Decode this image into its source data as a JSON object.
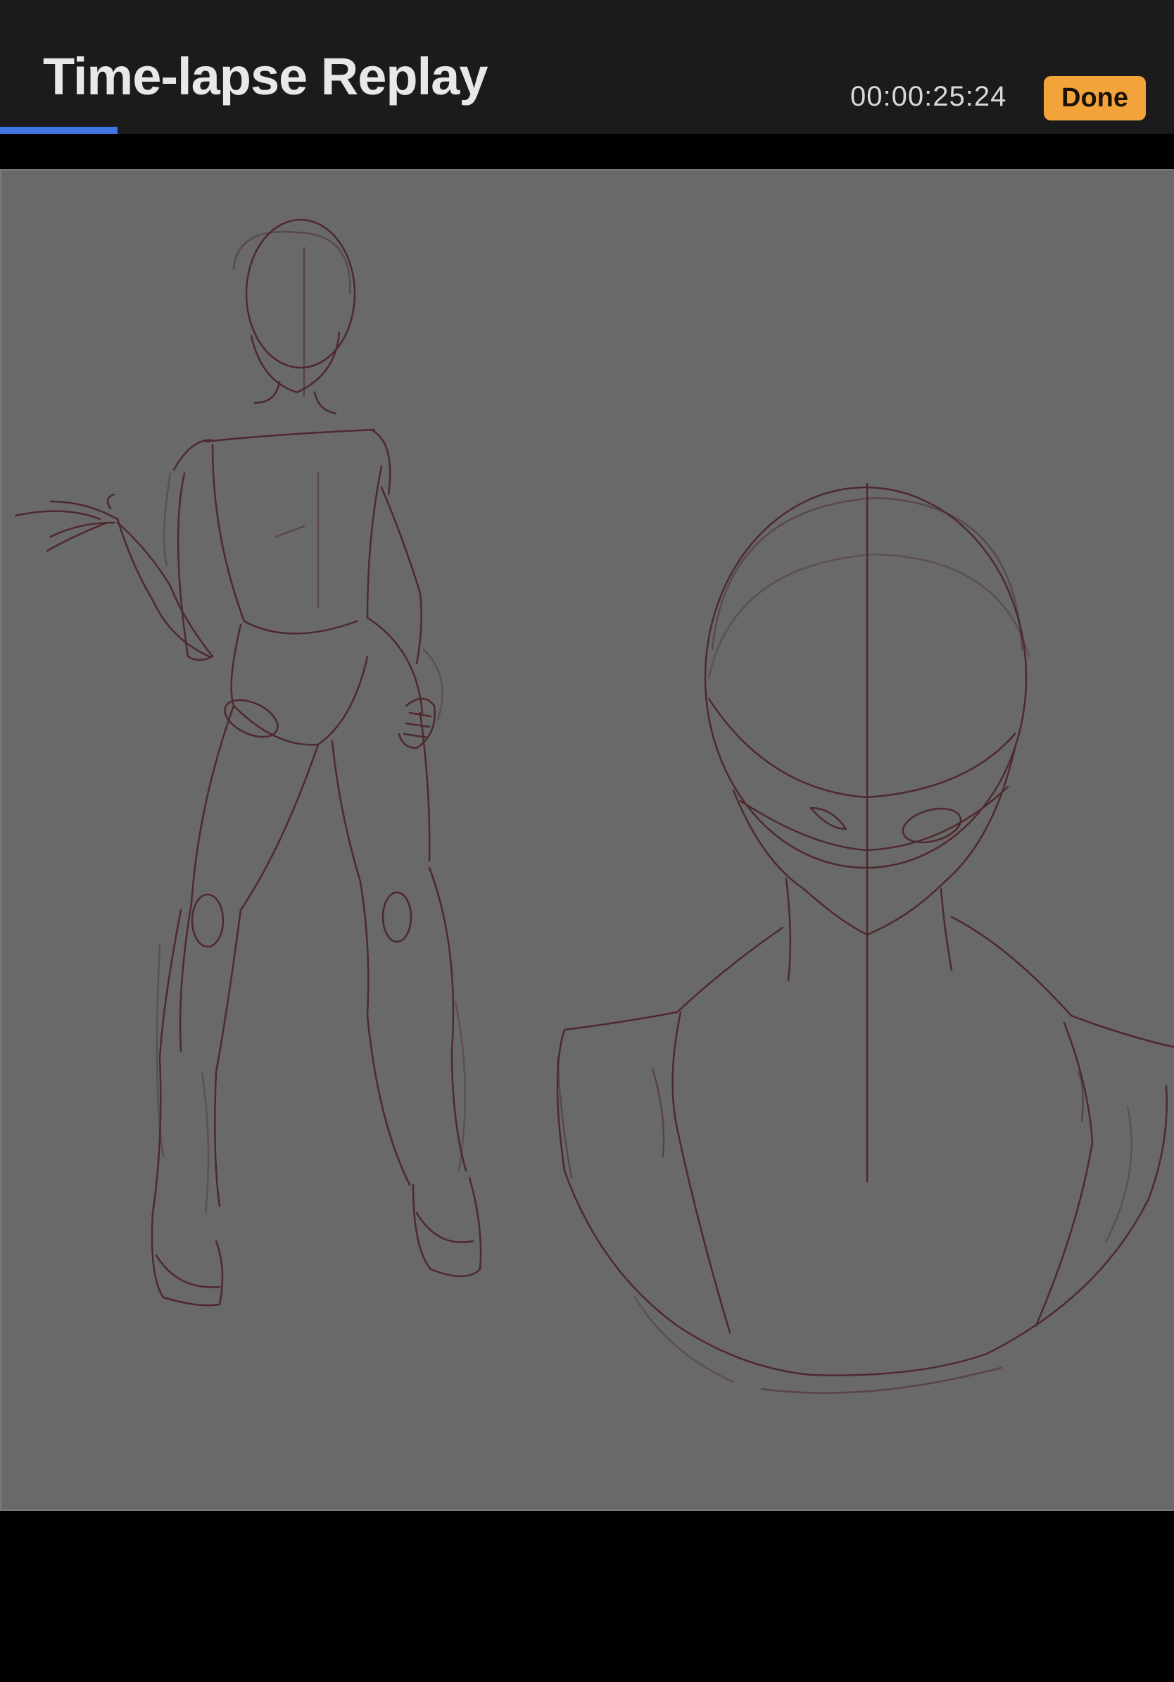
{
  "header": {
    "title": "Time-lapse Replay",
    "timer": "00:00:25:24",
    "done_label": "Done"
  },
  "playback": {
    "progress_fraction": 0.1
  },
  "colors": {
    "header_bg": "#1b1b1c",
    "accent_progress": "#3f74e4",
    "done_button": "#f2a33a",
    "canvas_bg": "#696969",
    "sketch_stroke": "#4a1e24"
  }
}
